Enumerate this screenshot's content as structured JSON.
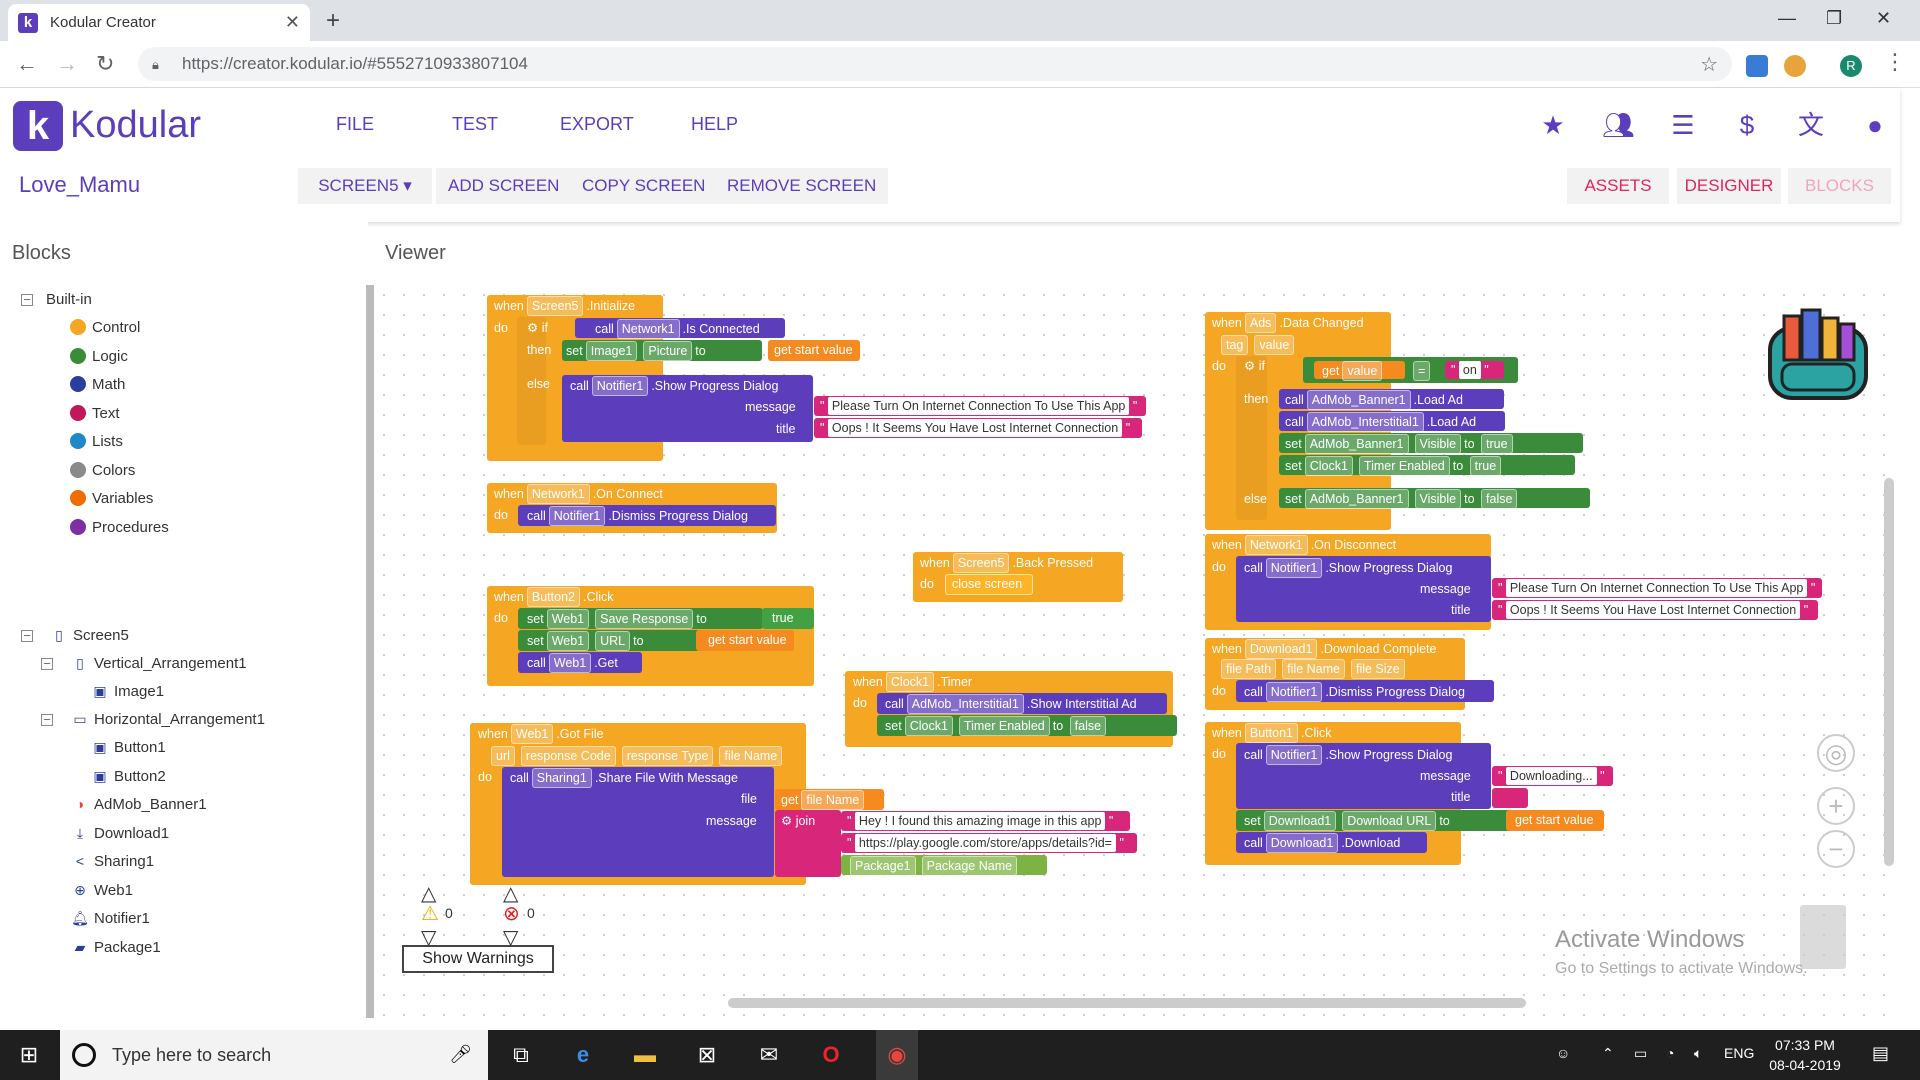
{
  "browser": {
    "tab_title": "Kodular Creator",
    "url": "https://creator.kodular.io/#5552710933807104"
  },
  "header": {
    "brand": "Kodular",
    "menu": [
      "FILE",
      "TEST",
      "EXPORT",
      "HELP"
    ],
    "project_name": "Love_Mamu",
    "screen_select": "SCREEN5 ▾",
    "add_screen": "ADD SCREEN",
    "copy_screen": "COPY SCREEN",
    "remove_screen": "REMOVE SCREEN",
    "assets": "ASSETS",
    "designer": "DESIGNER",
    "blocks": "BLOCKS"
  },
  "sidebar": {
    "title": "Blocks",
    "builtin_label": "Built-in",
    "builtin": [
      {
        "label": "Control",
        "color": "#f5a623"
      },
      {
        "label": "Logic",
        "color": "#3a8c3a"
      },
      {
        "label": "Math",
        "color": "#2c3e9c"
      },
      {
        "label": "Text",
        "color": "#c2185b"
      },
      {
        "label": "Lists",
        "color": "#1e88c8"
      },
      {
        "label": "Colors",
        "color": "#8a8a8a"
      },
      {
        "label": "Variables",
        "color": "#ef6c00"
      },
      {
        "label": "Procedures",
        "color": "#7b2fa0"
      }
    ],
    "screen_label": "Screen5",
    "components": [
      {
        "label": "Vertical_Arrangement1",
        "icon": "vertical-arrangement-icon"
      },
      {
        "label": "Image1",
        "icon": "image-icon"
      },
      {
        "label": "Horizontal_Arrangement1",
        "icon": "horizontal-arrangement-icon"
      },
      {
        "label": "Button1",
        "icon": "button-icon"
      },
      {
        "label": "Button2",
        "icon": "button-icon"
      },
      {
        "label": "AdMob_Banner1",
        "icon": "admob-icon"
      },
      {
        "label": "Download1",
        "icon": "download-icon"
      },
      {
        "label": "Sharing1",
        "icon": "share-icon"
      },
      {
        "label": "Web1",
        "icon": "globe-icon"
      },
      {
        "label": "Notifier1",
        "icon": "bell-icon"
      },
      {
        "label": "Package1",
        "icon": "package-icon"
      }
    ]
  },
  "viewer": {
    "title": "Viewer",
    "warnings_count": "0",
    "errors_count": "0",
    "show_warnings": "Show Warnings",
    "activate_title": "Activate Windows",
    "activate_sub": "Go to Settings to activate Windows."
  },
  "blocks": {
    "init": {
      "when": "when",
      "comp": "Screen5",
      "event": ".Initialize",
      "do": "do",
      "if": "if",
      "call": "call",
      "net": "Network1",
      "isconn": ".Is Connected",
      "then": "then",
      "set": "set",
      "img": "Image1",
      "picture": "Picture",
      "to": "to",
      "getstart": "get start value",
      "else": "else",
      "notifier": "Notifier1",
      "showprog": ".Show Progress Dialog",
      "message": "message",
      "title": "title",
      "msg": "Please Turn On Internet Connection To Use This App",
      "ttl": "Oops ! It Seems You Have Lost Internet Connection"
    },
    "onconnect": {
      "when": "when",
      "comp": "Network1",
      "event": ".On Connect",
      "do": "do",
      "call": "call",
      "notifier": "Notifier1",
      "action": ".Dismiss Progress Dialog"
    },
    "button2": {
      "when": "when",
      "comp": "Button2",
      "event": ".Click",
      "do": "do",
      "set": "set",
      "web": "Web1",
      "saveresp": "Save Response",
      "to": "to",
      "true": "true",
      "url": "URL",
      "getstart": "get start value",
      "call": "call",
      "get": ".Get"
    },
    "back": {
      "when": "when",
      "comp": "Screen5",
      "event": ".Back Pressed",
      "do": "do",
      "close": "close screen"
    },
    "clock": {
      "when": "when",
      "comp": "Clock1",
      "event": ".Timer",
      "do": "do",
      "call": "call",
      "admob": "AdMob_Interstitial1",
      "action": ".Show Interstitial Ad",
      "set": "set",
      "clock": "Clock1",
      "enabled": "Timer Enabled",
      "to": "to",
      "false": "false"
    },
    "gotfile": {
      "when": "when",
      "comp": "Web1",
      "event": ".Got File",
      "p1": "url",
      "p2": "response Code",
      "p3": "response Type",
      "p4": "file Name",
      "do": "do",
      "call": "call",
      "sharing": "Sharing1",
      "action": ".Share File With Message",
      "file": "file",
      "get": "get",
      "filename": "file Name",
      "message": "message",
      "join": "join",
      "str1": "Hey ! I found this amazing image in this app",
      "str2": "https://play.google.com/store/apps/details?id=",
      "pkg": "Package1",
      "pkgname": "Package Name"
    },
    "ads": {
      "when": "when",
      "comp": "Ads",
      "event": ".Data Changed",
      "tag": "tag",
      "value": "value",
      "do": "do",
      "if": "if",
      "get": "get",
      "getval": "value",
      "eq": "=",
      "on": "on",
      "then": "then",
      "call": "call",
      "banner": "AdMob_Banner1",
      "loadad": ".Load Ad",
      "inter": "AdMob_Interstitial1",
      "set": "set",
      "visible": "Visible",
      "to": "to",
      "true": "true",
      "clock": "Clock1",
      "enabled": "Timer Enabled",
      "else": "else",
      "false": "false"
    },
    "disconnect": {
      "when": "when",
      "comp": "Network1",
      "event": ".On Disconnect",
      "do": "do",
      "call": "call",
      "notifier": "Notifier1",
      "action": ".Show Progress Dialog",
      "message": "message",
      "title": "title",
      "msg": "Please Turn On Internet Connection To Use This App",
      "ttl": "Oops ! It Seems You Have Lost Internet Connection"
    },
    "dlcomplete": {
      "when": "when",
      "comp": "Download1",
      "event": ".Download Complete",
      "p1": "file Path",
      "p2": "file Name",
      "p3": "file Size",
      "do": "do",
      "call": "call",
      "notifier": "Notifier1",
      "action": ".Dismiss Progress Dialog"
    },
    "button1": {
      "when": "when",
      "comp": "Button1",
      "event": ".Click",
      "do": "do",
      "call": "call",
      "notifier": "Notifier1",
      "action": ".Show Progress Dialog",
      "message": "message",
      "title": "title",
      "msg": "Downloading...",
      "set": "set",
      "dl": "Download1",
      "dlurl": "Download URL",
      "to": "to",
      "getstart": "get start value",
      "download": ".Download"
    }
  },
  "taskbar": {
    "search_placeholder": "Type here to search",
    "lang": "ENG",
    "time": "07:33 PM",
    "date": "08-04-2019"
  },
  "colors": {
    "brand": "#5c3dbb",
    "accent": "#e0245e",
    "control": "#f5a623",
    "component": "#5c3dbb",
    "text": "#d8277a",
    "logic": "#3a8c3a"
  }
}
